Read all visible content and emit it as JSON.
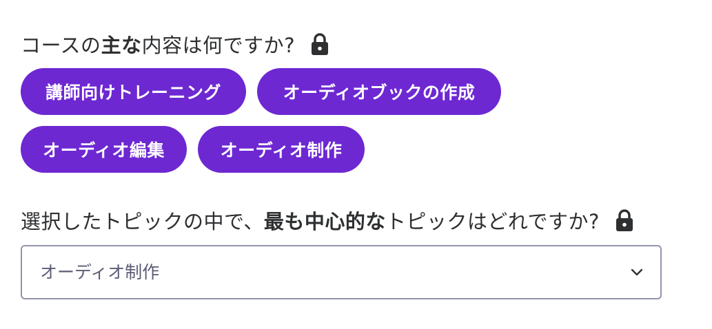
{
  "question1": {
    "part1": "コースの",
    "part2": "主な",
    "part3": "内容は何ですか?",
    "lock_icon": "lock-icon"
  },
  "topics": [
    {
      "label": "講師向けトレーニング"
    },
    {
      "label": "オーディオブックの作成"
    },
    {
      "label": "オーディオ編集"
    },
    {
      "label": "オーディオ制作"
    }
  ],
  "question2": {
    "part1": "選択したトピックの中で、",
    "part2": "最も中心的な",
    "part3": "トピックはどれですか?",
    "lock_icon": "lock-icon"
  },
  "select": {
    "value": "オーディオ制作",
    "icon": "chevron-down-icon"
  },
  "colors": {
    "chip_background": "#6d28d2",
    "chip_text": "#ffffff",
    "text": "#2d2f31",
    "select_border": "#9194ac",
    "select_text": "#595c73"
  }
}
